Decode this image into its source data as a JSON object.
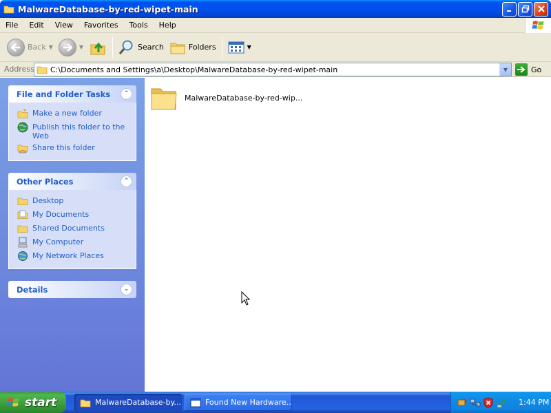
{
  "window": {
    "title": "MalwareDatabase-by-red-wipet-main"
  },
  "menu": [
    "File",
    "Edit",
    "View",
    "Favorites",
    "Tools",
    "Help"
  ],
  "toolbar": {
    "back_label": "Back",
    "search_label": "Search",
    "folders_label": "Folders"
  },
  "address": {
    "label": "Address",
    "value": "C:\\Documents and Settings\\a\\Desktop\\MalwareDatabase-by-red-wipet-main",
    "go_label": "Go"
  },
  "tasks_panel": {
    "title": "File and Folder Tasks",
    "items": [
      {
        "label": "Make a new folder",
        "icon": "new-folder-icon"
      },
      {
        "label": "Publish this folder to the Web",
        "icon": "publish-web-icon"
      },
      {
        "label": "Share this folder",
        "icon": "share-folder-icon"
      }
    ]
  },
  "places_panel": {
    "title": "Other Places",
    "items": [
      {
        "label": "Desktop",
        "icon": "desktop-folder-icon"
      },
      {
        "label": "My Documents",
        "icon": "my-documents-icon"
      },
      {
        "label": "Shared Documents",
        "icon": "shared-documents-icon"
      },
      {
        "label": "My Computer",
        "icon": "my-computer-icon"
      },
      {
        "label": "My Network Places",
        "icon": "network-places-icon"
      }
    ]
  },
  "details_panel": {
    "title": "Details"
  },
  "content": {
    "items": [
      {
        "label": "MalwareDatabase-by-red-wip...",
        "icon": "folder-icon"
      }
    ]
  },
  "taskbar": {
    "start_label": "start",
    "tasks": [
      {
        "label": "MalwareDatabase-by...",
        "active": true
      },
      {
        "label": "Found New Hardware...",
        "active": false
      }
    ],
    "clock": "1:44 PM"
  },
  "colors": {
    "titlebar": "#0050ee",
    "link": "#215dc6",
    "taskpane_top": "#7ba2e7",
    "taskpane_bottom": "#6375d6",
    "taskbar": "#2663e0",
    "start": "#3a9c3a"
  }
}
